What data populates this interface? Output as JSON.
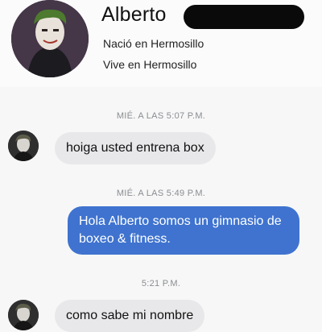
{
  "profile": {
    "name": "Alberto",
    "born": "Nació en Hermosillo",
    "lives": "Vive en Hermosillo"
  },
  "conversation": {
    "timestamps": [
      "MIÉ. A LAS 5:07 P.M.",
      "MIÉ. A LAS 5:49 P.M.",
      "5:21 P.M."
    ],
    "messages": [
      {
        "sender": "contact",
        "text": "hoiga usted entrena box"
      },
      {
        "sender": "me",
        "text": "Hola Alberto somos un gimnasio de boxeo & fitness."
      },
      {
        "sender": "contact",
        "text": "como sabe mi nombre"
      }
    ]
  },
  "colors": {
    "outgoing_bubble": "#3f73cf",
    "incoming_bubble": "#e8e8ea",
    "timestamp_text": "#8a8d91"
  }
}
